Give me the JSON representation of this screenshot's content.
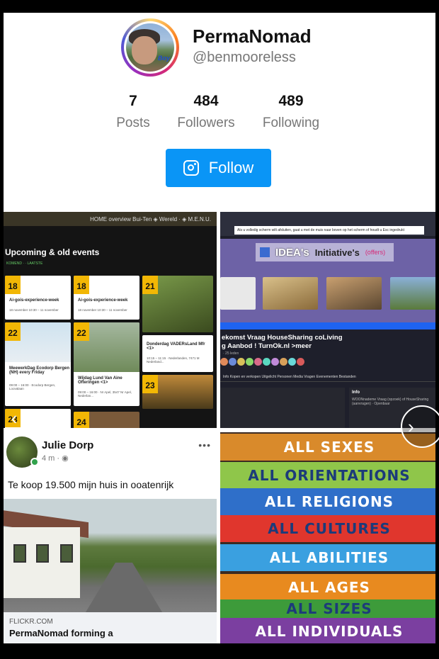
{
  "profile": {
    "name": "PermaNomad",
    "handle": "@benmooreless",
    "avatar_caption": "Boy"
  },
  "stats": [
    {
      "value": "7",
      "label": "Posts"
    },
    {
      "value": "484",
      "label": "Followers"
    },
    {
      "value": "489",
      "label": "Following"
    }
  ],
  "follow_button": {
    "label": "Follow",
    "icon": "instagram-icon",
    "color": "#0a95f6"
  },
  "tiles": {
    "events": {
      "topbar": "HOME overview Bui-Ten ◈ Wereld · ◈ M.E.N.U.",
      "heading": "Upcoming & old events",
      "filter": "KOMEND · · LAATSTE",
      "cards": [
        {
          "day": "18",
          "title": "Ai-gois-experience-week",
          "meta": "18 november 10:30 – 11 november"
        },
        {
          "day": "18",
          "title": "Ai-gois-experience-week",
          "meta": "18 november 10:30 – 11 november"
        },
        {
          "day": "21",
          "title": "",
          "meta": ""
        },
        {
          "day": "22",
          "title": "MeewerkDag Ecodorp Bergen (NH) every Friday",
          "meta": "09:00 – 16:00 · Ecodorp Bergen, Loovalaan"
        },
        {
          "day": "22",
          "title": "Wijdag Lund Van Aine Ofteringen <1>",
          "meta": "09:00 – 16:00 · Nr Apel, 3547 Nr Apel, Nederlan..."
        },
        {
          "day": "",
          "title": "Donderdag VADERsLand Mfr <1>",
          "meta": "10:15 – 11:15 · Nederlanden, 7471 M Nederland..."
        },
        {
          "day": "23",
          "title": "",
          "meta": ""
        },
        {
          "day": "23",
          "title": "",
          "meta": ""
        },
        {
          "day": "24",
          "title": "",
          "meta": ""
        }
      ]
    },
    "idea": {
      "notice": "Als u volledig scherm wilt afsluiten, gaat u met de muis naar boven op het scherm of houdt u  Esc ingedrukt",
      "banner_word1": "IDEA's",
      "banner_word2": "Initiative's",
      "banner_word3": "(offers)",
      "title_line1": "ekomst Vraag HouseSharing coLiving",
      "title_line2": "g Aanbod ! TurnOk.nl >meer",
      "members": "· 25 leden",
      "tabs": "Info   Kopen en verkopen   Uitgelicht   Personen   Media   Vragen   Evenementen   Bestanden",
      "side_info": "Info",
      "side_text": "WOONnademe Vraag (opzoek) of HouseSharing (aanvragen) · Openbaar"
    },
    "post": {
      "author": "Julie Dorp",
      "time": "4 m · ◉",
      "text": "Te koop 19.500 mijn huis in ooatenrijk",
      "link_source": "FLICKR.COM",
      "link_title": "PermaNomad forming a"
    },
    "boards": [
      {
        "text": "ALL SEXES",
        "color": "#d98a2b"
      },
      {
        "text": "ALL ORIENTATIONS",
        "color": "#8fc64a"
      },
      {
        "text": "ALL RELIGIONS",
        "color": "#2f6fc9"
      },
      {
        "text": "ALL CULTURES",
        "color": "#e0362d"
      },
      {
        "text": "ALL ABILITIES",
        "color": "#3aa0e0"
      },
      {
        "text": "ALL AGES",
        "color": "#e88a1f"
      },
      {
        "text": "ALL SIZES",
        "color": "#3d9b3a"
      },
      {
        "text": "ALL INDIVIDUALS",
        "color": "#7b3fa0"
      }
    ]
  },
  "arrows": {
    "left": "‹",
    "right": "›"
  }
}
